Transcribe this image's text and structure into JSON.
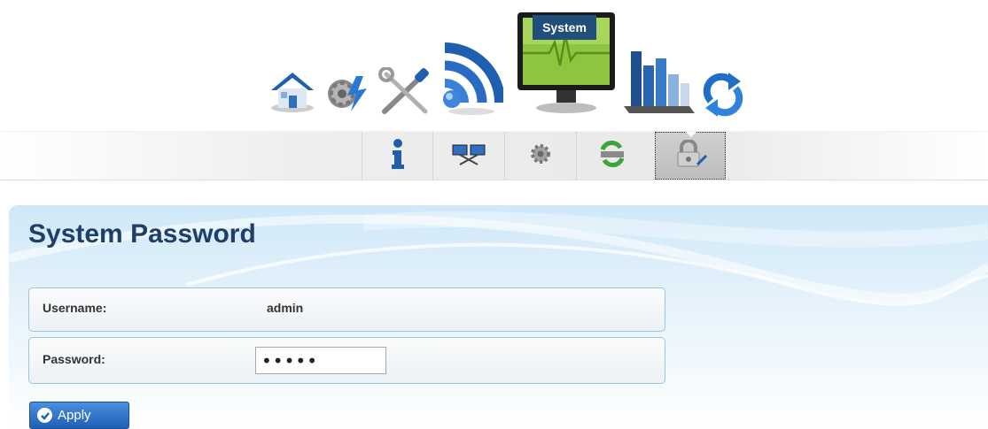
{
  "main_nav": {
    "items": [
      {
        "icon": "home-icon"
      },
      {
        "icon": "quick-setup-gear-icon"
      },
      {
        "icon": "tools-icon"
      },
      {
        "icon": "wireless-icon"
      },
      {
        "icon": "system-monitor-icon",
        "active": true
      },
      {
        "icon": "statistics-chart-icon"
      },
      {
        "icon": "refresh-icon"
      }
    ],
    "tooltip": "System"
  },
  "sub_nav": {
    "items": [
      {
        "icon": "info-icon"
      },
      {
        "icon": "network-icon"
      },
      {
        "icon": "settings-gear-icon"
      },
      {
        "icon": "update-icon"
      },
      {
        "icon": "password-lock-icon",
        "active": true
      }
    ]
  },
  "page": {
    "title": "System Password"
  },
  "form": {
    "username_label": "Username:",
    "username_value": "admin",
    "password_label": "Password:",
    "password_value": "•••••"
  },
  "actions": {
    "apply_label": "Apply"
  },
  "colors": {
    "title": "#1f3f66",
    "apply_button": "#2f74cc",
    "tooltip_bg": "#1f4f7a"
  }
}
